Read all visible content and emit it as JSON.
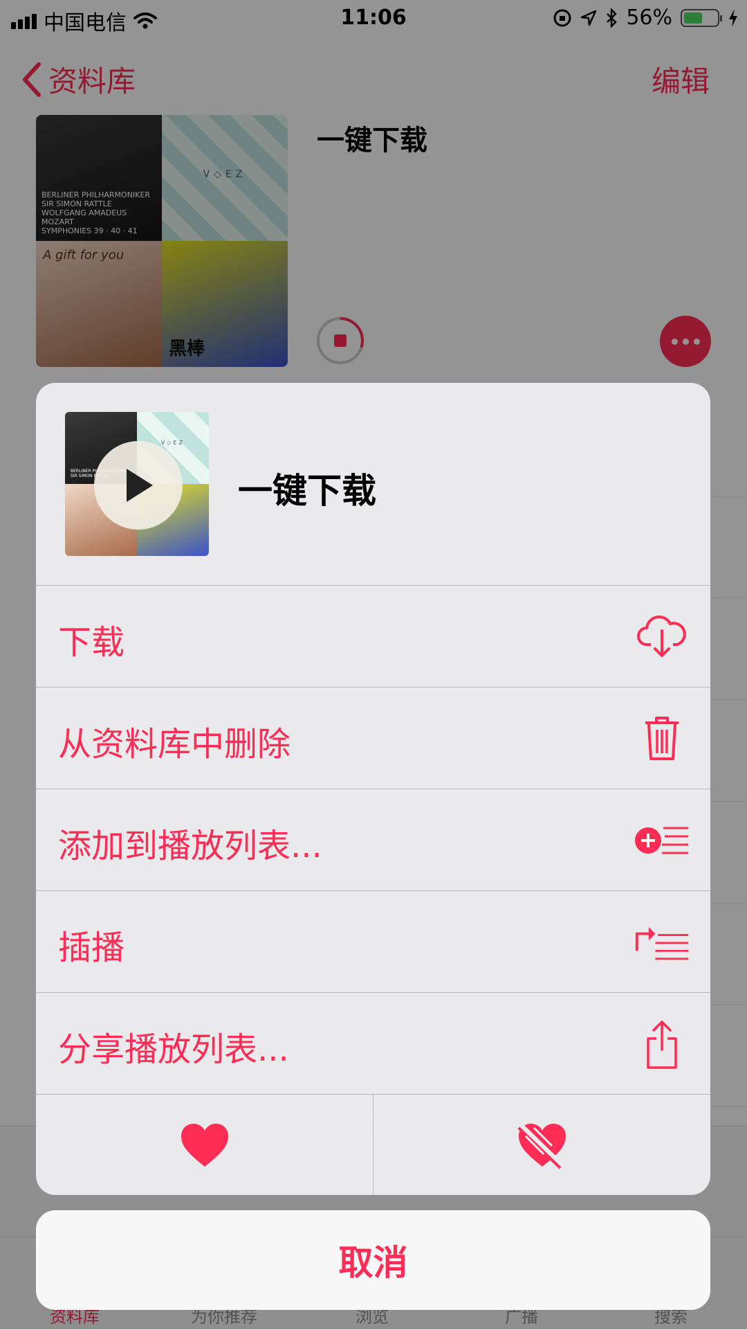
{
  "status_bar": {
    "carrier": "中国电信",
    "time": "11:06",
    "battery_percent": "56%",
    "battery_level": 0.56
  },
  "nav": {
    "back_label": "资料库",
    "edit_label": "编辑"
  },
  "playlist": {
    "title": "一键下载",
    "cover_text": {
      "q1": [
        "BERLINER PHILHARMONIKER",
        "SIR SIMON RATTLE",
        "WOLFGANG AMADEUS MOZART",
        "SYMPHONIES 39 · 40 · 41"
      ],
      "q2": "V◇EZ",
      "q3": "A gift for you",
      "q4": "黑棒"
    },
    "download_progress": 0.3
  },
  "sheet": {
    "title": "一键下载",
    "items": [
      {
        "label": "下载",
        "icon": "cloud-download-icon"
      },
      {
        "label": "从资料库中删除",
        "icon": "trash-icon"
      },
      {
        "label": "添加到播放列表...",
        "icon": "add-to-playlist-icon"
      },
      {
        "label": "插播",
        "icon": "play-next-icon"
      },
      {
        "label": "分享播放列表...",
        "icon": "share-icon"
      }
    ],
    "love_icon": "heart-icon",
    "dislike_icon": "heart-slash-icon",
    "cancel_label": "取消"
  },
  "tabs": [
    {
      "label": "资料库",
      "active": true
    },
    {
      "label": "为你推荐",
      "active": false
    },
    {
      "label": "浏览",
      "active": false
    },
    {
      "label": "广播",
      "active": false
    },
    {
      "label": "搜索",
      "active": false
    }
  ],
  "colors": {
    "accent": "#ff2d55",
    "battery": "#4cd964",
    "sheet_bg": "#ececee",
    "separator": "#b9b9bd"
  }
}
